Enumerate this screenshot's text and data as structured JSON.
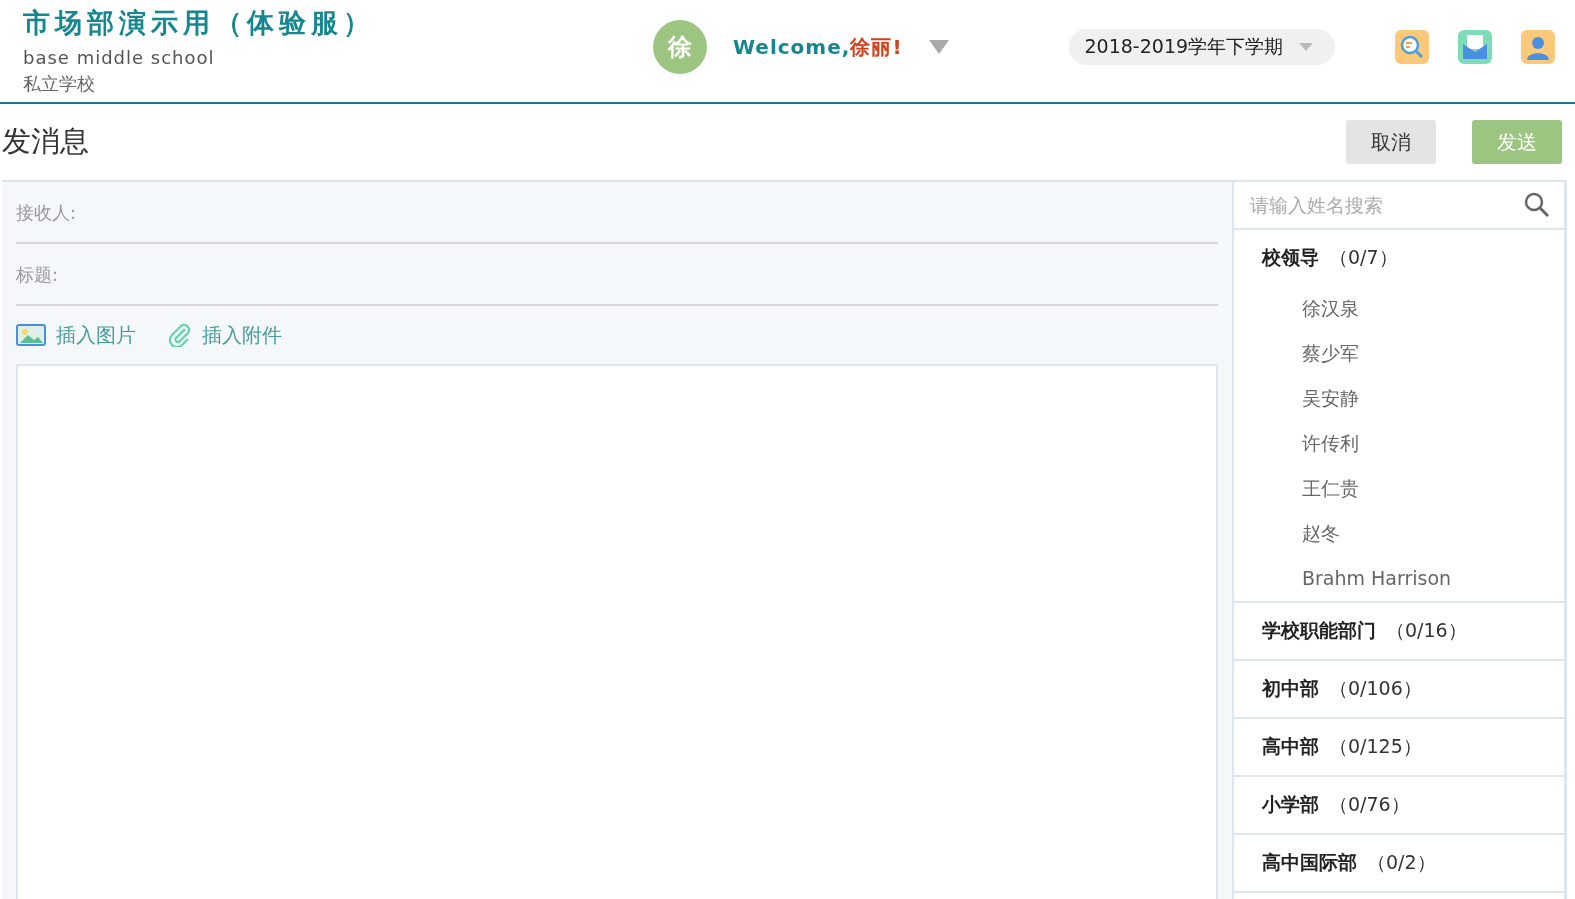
{
  "header": {
    "title": "市场部演示用（体验服）",
    "subtitle": "base middle school",
    "school_type": "私立学校",
    "avatar": "徐",
    "greeting": "Welcome,",
    "user_name": "徐丽!",
    "term": "2018-2019学年下学期"
  },
  "page": {
    "title": "发消息",
    "cancel": "取消",
    "send": "发送"
  },
  "form": {
    "recipient_label": "接收人:",
    "subject_label": "标题:",
    "insert_image": "插入图片",
    "insert_attachment": "插入附件"
  },
  "contacts": {
    "search_placeholder": "请输入姓名搜索",
    "groups": [
      {
        "name": "校领导",
        "count": "（0/7）",
        "members": [
          "徐汉泉",
          "蔡少军",
          "吴安静",
          "许传利",
          "王仁贵",
          "赵冬",
          "Brahm Harrison"
        ]
      },
      {
        "name": "学校职能部门",
        "count": "（0/16）"
      },
      {
        "name": "初中部",
        "count": "（0/106）"
      },
      {
        "name": "高中部",
        "count": "（0/125）"
      },
      {
        "name": "小学部",
        "count": "（0/76）"
      },
      {
        "name": "高中国际部",
        "count": "（0/2）"
      }
    ]
  }
}
